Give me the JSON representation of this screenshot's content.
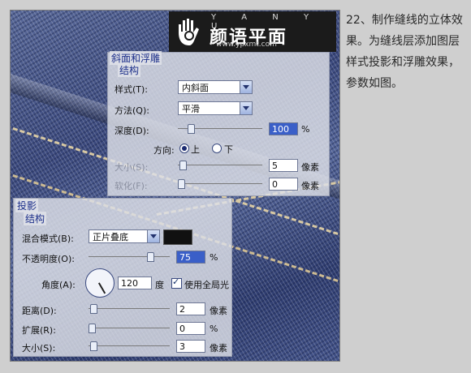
{
  "watermark": {
    "letters": "Y A N Y U",
    "title": "颜语平面",
    "url": "www.ypxmt.com"
  },
  "caption": "22、制作缝线的立体效果。为缝线层添加图层样式投影和浮雕效果，参数如图。",
  "bevel_panel": {
    "title": "斜面和浮雕",
    "subtitle": "结构",
    "style_label": "样式(T):",
    "style_value": "内斜面",
    "technique_label": "方法(Q):",
    "technique_value": "平滑",
    "depth_label": "深度(D):",
    "depth_value": "100",
    "depth_unit": "%",
    "direction_label": "方向:",
    "direction_up": "上",
    "direction_down": "下",
    "direction_selected": "上",
    "size_label": "大小(S):",
    "size_value": "5",
    "size_unit": "像素",
    "soften_label": "软化(F):",
    "soften_value": "0",
    "soften_unit": "像素"
  },
  "shadow_panel": {
    "title": "投影",
    "subtitle": "结构",
    "blend_label": "混合模式(B):",
    "blend_value": "正片叠底",
    "shadow_color": "#111111",
    "opacity_label": "不透明度(O):",
    "opacity_value": "75",
    "opacity_unit": "%",
    "angle_label": "角度(A):",
    "angle_value": "120",
    "angle_unit": "度",
    "global_light_label": "使用全局光",
    "global_light_checked": true,
    "distance_label": "距离(D):",
    "distance_value": "2",
    "distance_unit": "像素",
    "spread_label": "扩展(R):",
    "spread_value": "0",
    "spread_unit": "%",
    "size_label": "大小(S):",
    "size_value": "3",
    "size_unit": "像素"
  },
  "colors": {
    "group_title": "#1c2f8a",
    "selected_field": "#3a5fc8",
    "background": "#cfcfcf"
  }
}
